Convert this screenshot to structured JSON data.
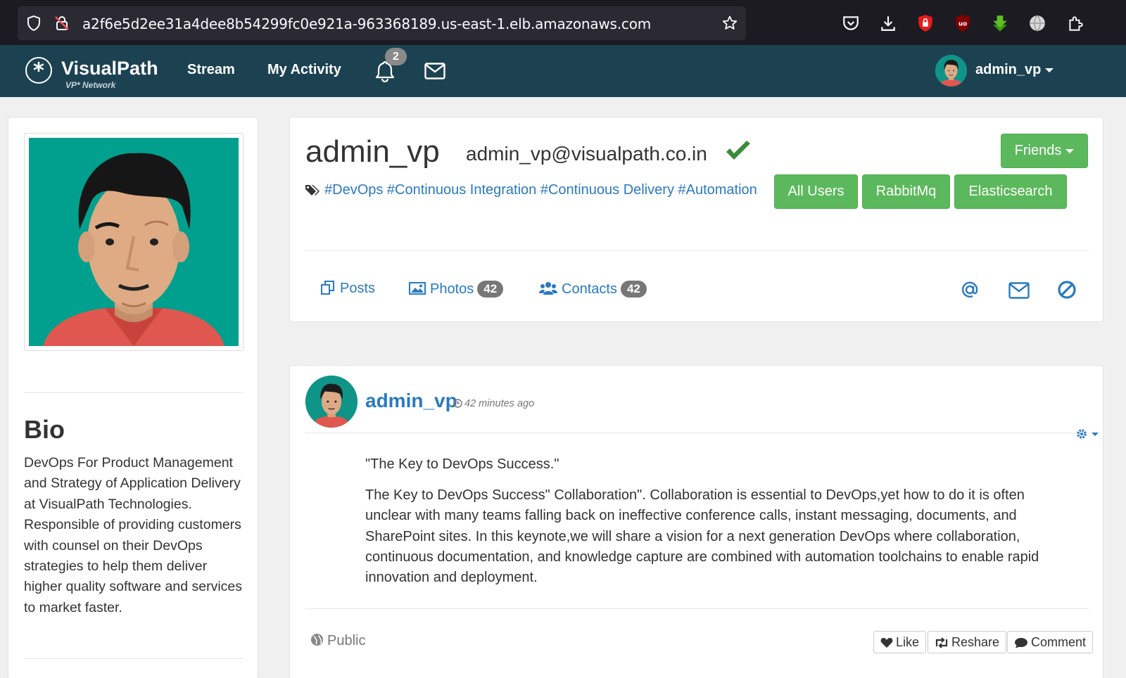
{
  "browser": {
    "url": "a2f6e5d2ee31a4dee8b54299fc0e921a-963368189.us-east-1.elb.amazonaws.com"
  },
  "navbar": {
    "brand": "VisualPath",
    "brand_sub": "VP* Network",
    "links": [
      "Stream",
      "My Activity"
    ],
    "notification_count": "2",
    "username": "admin_vp",
    "colors": {
      "bg": "#1c4252"
    }
  },
  "profile": {
    "bio_title": "Bio",
    "bio": "DevOps For Product Management and Strategy of Application Delivery at VisualPath Technologies. Responsible of providing customers with counsel on their DevOps strategies to help them deliver higher quality software and services to market faster."
  },
  "header": {
    "name": "admin_vp",
    "email": "admin_vp@visualpath.co.in",
    "friends_label": "Friends",
    "tags": "#DevOps #Continuous Integration #Continuous Delivery #Automation",
    "tag_buttons": [
      "All Users",
      "RabbitMq",
      "Elasticsearch"
    ],
    "tabs": [
      {
        "label": "Posts",
        "icon": "posts-icon"
      },
      {
        "label": "Photos",
        "count": "42",
        "icon": "photo-icon"
      },
      {
        "label": "Contacts",
        "count": "42",
        "icon": "users-icon"
      }
    ],
    "actions": [
      "mention-icon",
      "envelope-icon",
      "block-icon"
    ],
    "colors": {
      "green": "#5cb85c",
      "link": "#2a7ac0"
    }
  },
  "post": {
    "author": "admin_vp",
    "time": "42 minutes ago",
    "title": "\"The Key to DevOps Success.\"",
    "body": "The Key to DevOps Success\" Collaboration\". Collaboration is essential to DevOps,yet how to do it is often unclear with many teams falling back on ineffective conference calls, instant messaging, documents, and SharePoint sites. In this keynote,we will share a vision for a next generation DevOps where collaboration, continuous documentation, and knowledge capture are combined with automation toolchains to enable rapid innovation and deployment.",
    "visibility": "Public",
    "buttons": [
      "Like",
      "Reshare",
      "Comment"
    ]
  }
}
